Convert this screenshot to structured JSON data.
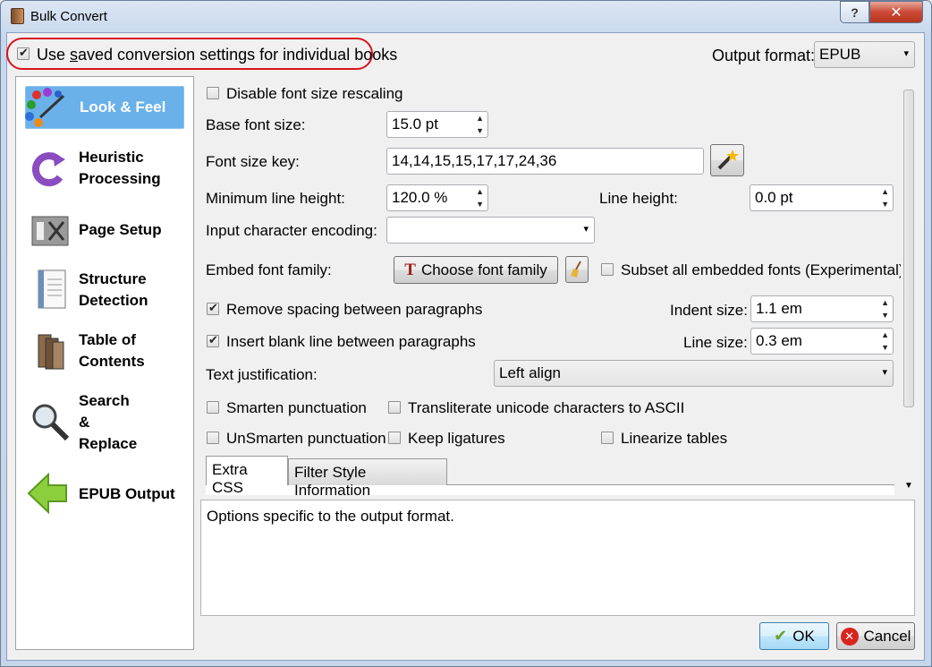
{
  "window": {
    "title": "Bulk Convert",
    "help_label": "?",
    "close_label": "✕"
  },
  "top": {
    "use_saved_label_pre": "Use ",
    "use_saved_label_u": "s",
    "use_saved_label_post": "aved conversion settings for individual books",
    "use_saved_checked": true,
    "output_format_label": "Output format:",
    "output_format_value": "EPUB"
  },
  "sidebar": {
    "items": [
      {
        "label1": "Look & Feel",
        "label2": "",
        "icon": "palette-icon",
        "selected": true
      },
      {
        "label1": "Heuristic",
        "label2": "Processing",
        "icon": "refresh-arrow-icon"
      },
      {
        "label1": "Page Setup",
        "label2": "",
        "icon": "page-setup-tools-icon"
      },
      {
        "label1": "Structure",
        "label2": "Detection",
        "icon": "document-icon"
      },
      {
        "label1": "Table of",
        "label2": "Contents",
        "icon": "books-icon"
      },
      {
        "label1": "Search",
        "label2": "&",
        "label3": "Replace",
        "icon": "magnifier-icon"
      },
      {
        "label1": "EPUB Output",
        "label2": "",
        "icon": "green-arrow-left-icon"
      }
    ]
  },
  "form": {
    "disable_font_rescaling": "Disable font size rescaling",
    "base_font_size_label": "Base font size:",
    "base_font_size_value": "15.0 pt",
    "font_size_key_label": "Font size key:",
    "font_size_key_value": "14,14,15,15,17,17,24,36",
    "min_line_height_label": "Minimum line height:",
    "min_line_height_value": "120.0 %",
    "line_height_label": "Line height:",
    "line_height_value": "0.0 pt",
    "input_encoding_label": "Input character encoding:",
    "input_encoding_value": "",
    "embed_font_label": "Embed font family:",
    "choose_font_button": "Choose font family",
    "subset_fonts_label": "Subset all embedded fonts (Experimental)",
    "remove_spacing_label": "Remove spacing between paragraphs",
    "remove_spacing_checked": true,
    "indent_size_label": "Indent size:",
    "indent_size_value": "1.1 em",
    "insert_blank_label": "Insert blank line between paragraphs",
    "insert_blank_checked": true,
    "line_size_label": "Line size:",
    "line_size_value": "0.3 em",
    "text_justification_label": "Text justification:",
    "text_justification_value": "Left align",
    "smarten_label": "Smarten punctuation",
    "transliterate_label": "Transliterate unicode characters to ASCII",
    "unsmarten_label": "UnSmarten punctuation",
    "keep_ligatures_label": "Keep ligatures",
    "linearize_tables_label": "Linearize tables"
  },
  "tabs": [
    {
      "label": "Extra CSS",
      "active": true
    },
    {
      "label": "Filter Style Information",
      "active": false
    }
  ],
  "description": "Options specific to the output format.",
  "buttons": {
    "ok": "OK",
    "cancel": "Cancel"
  }
}
